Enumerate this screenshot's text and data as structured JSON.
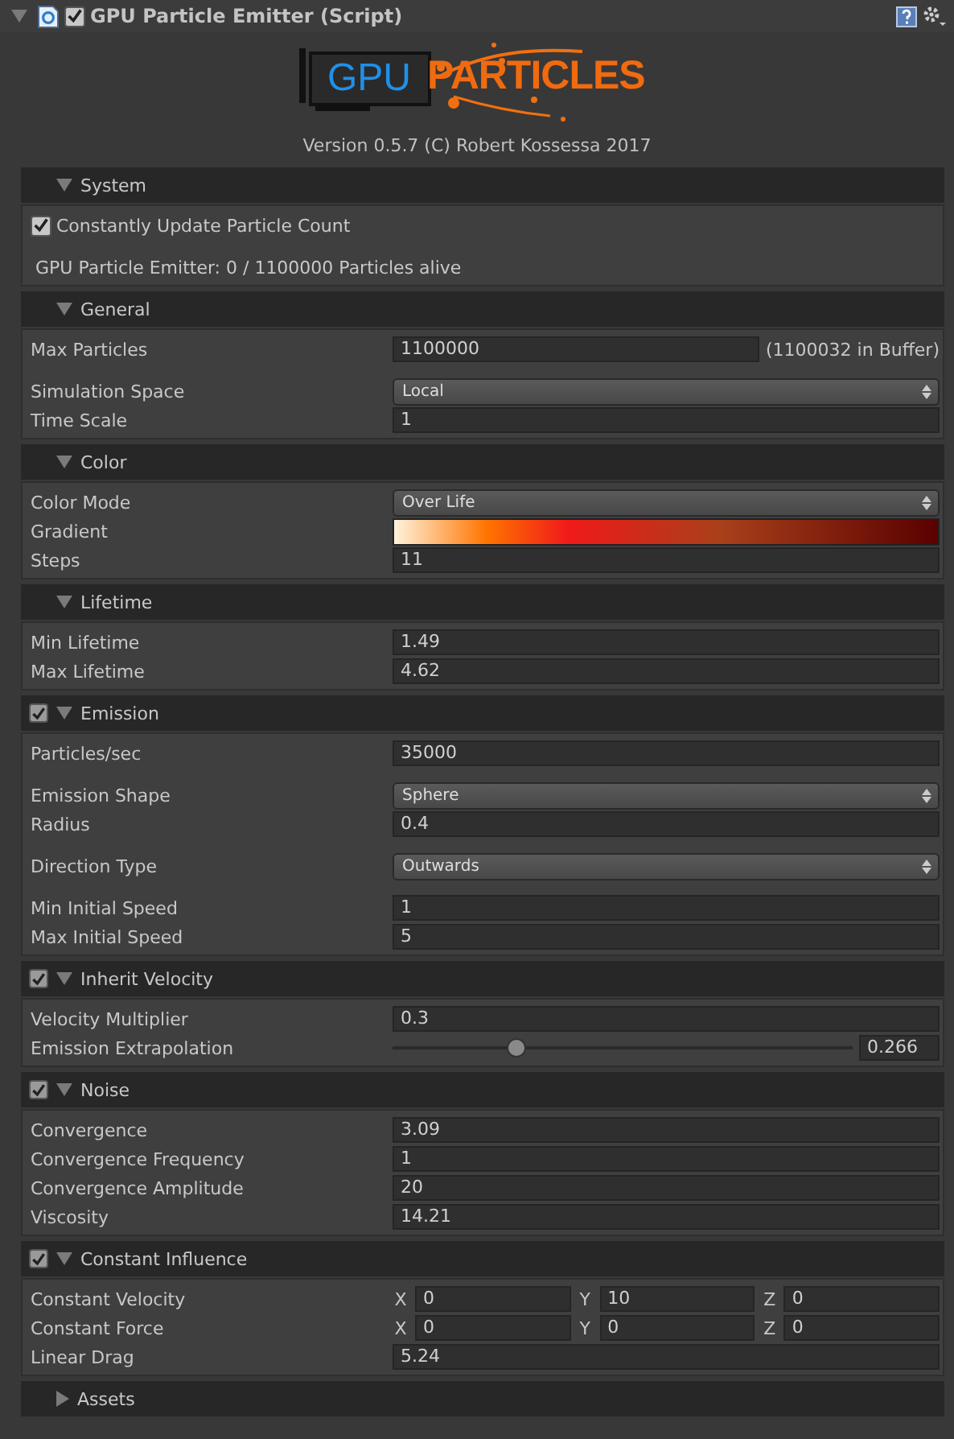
{
  "component": {
    "title": "GPU Particle Emitter (Script)",
    "expanded": true,
    "enabled": true
  },
  "logo": {
    "left": "GPU",
    "right": "PARTICLES"
  },
  "version": "Version 0.5.7 (C) Robert Kossessa 2017",
  "sections": [
    {
      "title": "System",
      "expanded": true,
      "rows": [
        {
          "kind": "toggle",
          "label": "Constantly Update Particle Count",
          "checked": true
        },
        {
          "kind": "info",
          "label": "GPU Particle Emitter: 0 / 1100000 Particles alive",
          "spaced": true
        }
      ]
    },
    {
      "title": "General",
      "expanded": true,
      "rows": [
        {
          "kind": "field",
          "label": "Max Particles",
          "value": "1100000",
          "suffix": "(1100032 in Buffer)"
        },
        {
          "kind": "dropdown",
          "label": "Simulation Space",
          "value": "Local",
          "spaced": true
        },
        {
          "kind": "field",
          "label": "Time Scale",
          "value": "1"
        }
      ]
    },
    {
      "title": "Color",
      "expanded": true,
      "rows": [
        {
          "kind": "dropdown",
          "label": "Color Mode",
          "value": "Over Life"
        },
        {
          "kind": "gradient",
          "label": "Gradient"
        },
        {
          "kind": "field",
          "label": "Steps",
          "value": "11"
        }
      ]
    },
    {
      "title": "Lifetime",
      "expanded": true,
      "rows": [
        {
          "kind": "field",
          "label": "Min Lifetime",
          "value": "1.49"
        },
        {
          "kind": "field",
          "label": "Max Lifetime",
          "value": "4.62"
        }
      ]
    },
    {
      "title": "Emission",
      "expanded": true,
      "enabled": true,
      "rows": [
        {
          "kind": "field",
          "label": "Particles/sec",
          "value": "35000"
        },
        {
          "kind": "dropdown",
          "label": "Emission Shape",
          "value": "Sphere",
          "spaced": true
        },
        {
          "kind": "field",
          "label": "Radius",
          "value": "0.4"
        },
        {
          "kind": "dropdown",
          "label": "Direction Type",
          "value": "Outwards",
          "spaced": true
        },
        {
          "kind": "field",
          "label": "Min Initial Speed",
          "value": "1",
          "spaced": true
        },
        {
          "kind": "field",
          "label": "Max Initial Speed",
          "value": "5"
        }
      ]
    },
    {
      "title": "Inherit Velocity",
      "expanded": true,
      "enabled": true,
      "rows": [
        {
          "kind": "field",
          "label": "Velocity Multiplier",
          "value": "0.3"
        },
        {
          "kind": "slider",
          "label": "Emission Extrapolation",
          "level": 0.27,
          "value": "0.266"
        }
      ]
    },
    {
      "title": "Noise",
      "expanded": true,
      "enabled": true,
      "rows": [
        {
          "kind": "field",
          "label": "Convergence",
          "value": "3.09"
        },
        {
          "kind": "field",
          "label": "Convergence Frequency",
          "value": "1"
        },
        {
          "kind": "field",
          "label": "Convergence Amplitude",
          "value": "20"
        },
        {
          "kind": "field",
          "label": "Viscosity",
          "value": "14.21"
        }
      ]
    },
    {
      "title": "Constant Influence",
      "expanded": true,
      "enabled": true,
      "rows": [
        {
          "kind": "vector",
          "label": "Constant Velocity",
          "components": [
            {
              "axis": "X",
              "value": "0"
            },
            {
              "axis": "Y",
              "value": "10"
            },
            {
              "axis": "Z",
              "value": "0"
            }
          ]
        },
        {
          "kind": "vector",
          "label": "Constant Force",
          "components": [
            {
              "axis": "X",
              "value": "0"
            },
            {
              "axis": "Y",
              "value": "0"
            },
            {
              "axis": "Z",
              "value": "0"
            }
          ]
        },
        {
          "kind": "field",
          "label": "Linear Drag",
          "value": "5.24"
        }
      ]
    },
    {
      "title": "Assets",
      "expanded": false
    }
  ]
}
